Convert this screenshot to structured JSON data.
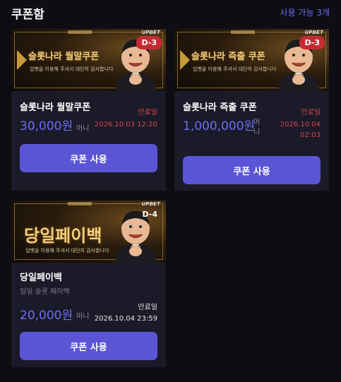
{
  "header": {
    "title": "쿠폰함",
    "available": "사용 가능 3개"
  },
  "coupons": [
    {
      "banner_title": "슬롯나라 월말쿠폰",
      "banner_sub": "업벳을 이용해 주셔서 대단히 감사합니다",
      "brand": "UPBET",
      "d_badge": "D-3",
      "name": "슬롯나라 월말쿠폰",
      "amount": "30,000원",
      "unit": "머니",
      "expiry_label": "만료일",
      "expiry": "2026.10.03 12:20",
      "button": "쿠폰 사용"
    },
    {
      "banner_title": "슬롯나라 즉출 쿠폰",
      "banner_sub": "업벳을 이용해 주셔서 대단히 감사합니다",
      "brand": "UPBET",
      "d_badge": "D-3",
      "name": "슬롯나라 즉출 쿠폰",
      "amount": "1,000,000원",
      "unit": "머니",
      "expiry_label": "만료일",
      "expiry_date": "2026.10.04",
      "expiry_time": "02:03",
      "button": "쿠폰 사용"
    },
    {
      "banner_title": "당일페이백",
      "banner_sub": "업벳을 이용해 주셔서 대단히 감사합니다",
      "brand": "UPBET",
      "d_badge": "D-4",
      "name": "당일페이백",
      "description": "일일 슬롯 페이백",
      "amount": "20,000원",
      "unit": "머니",
      "expiry_label": "만료일",
      "expiry": "2026.10.04 23:59",
      "button": "쿠폰 사용"
    }
  ],
  "colors": {
    "background": "#0d0d13",
    "card": "#1a1a28",
    "accent": "#5b55d6",
    "amount": "#6d6df5",
    "badge": "#c62b33",
    "expiry_red": "#d6464d"
  }
}
